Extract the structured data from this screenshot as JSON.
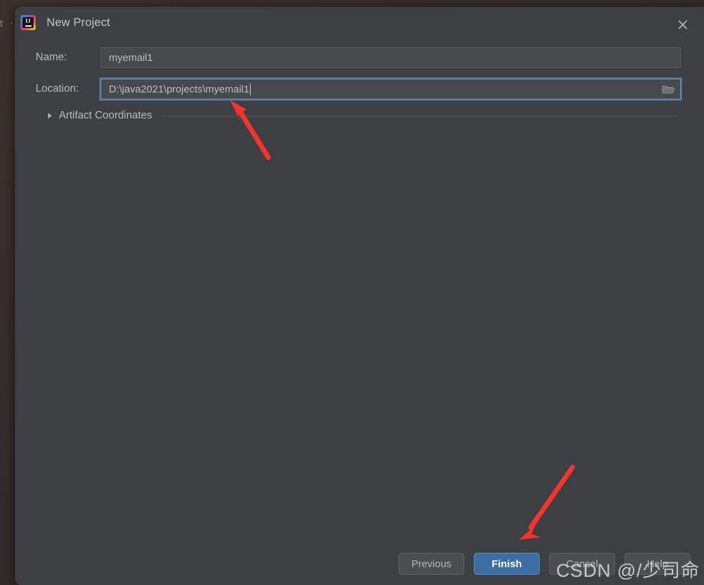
{
  "background": {
    "fragment_text": "t",
    "fragment_dash": "-"
  },
  "dialog": {
    "title": "New Project",
    "app_icon": "intellij-idea-icon",
    "close_icon": "close-icon"
  },
  "form": {
    "name": {
      "label": "Name:",
      "value": "myemail1",
      "placeholder": ""
    },
    "location": {
      "label": "Location:",
      "value": "D:\\java2021\\projects\\myemail1",
      "placeholder": "",
      "browse_icon": "folder-icon",
      "focused": true
    },
    "artifact_coordinates": {
      "label": "Artifact Coordinates",
      "expander_icon": "chevron-right-icon",
      "expanded": false
    }
  },
  "buttons": {
    "previous": "Previous",
    "finish": "Finish",
    "cancel": "Cancel",
    "help": "Help"
  },
  "colors": {
    "dialog_background": "#3c4043",
    "field_background": "#45494c",
    "focus_ring": "#4a76a8",
    "primary_button": "#3b6ea5",
    "annotation_arrow": "#f8332c",
    "text": "#b9bbbd"
  },
  "annotations": {
    "arrow_location_target": "Location field",
    "arrow_finish_target": "Finish button"
  },
  "watermark": {
    "text": "CSDN @/少司命"
  }
}
